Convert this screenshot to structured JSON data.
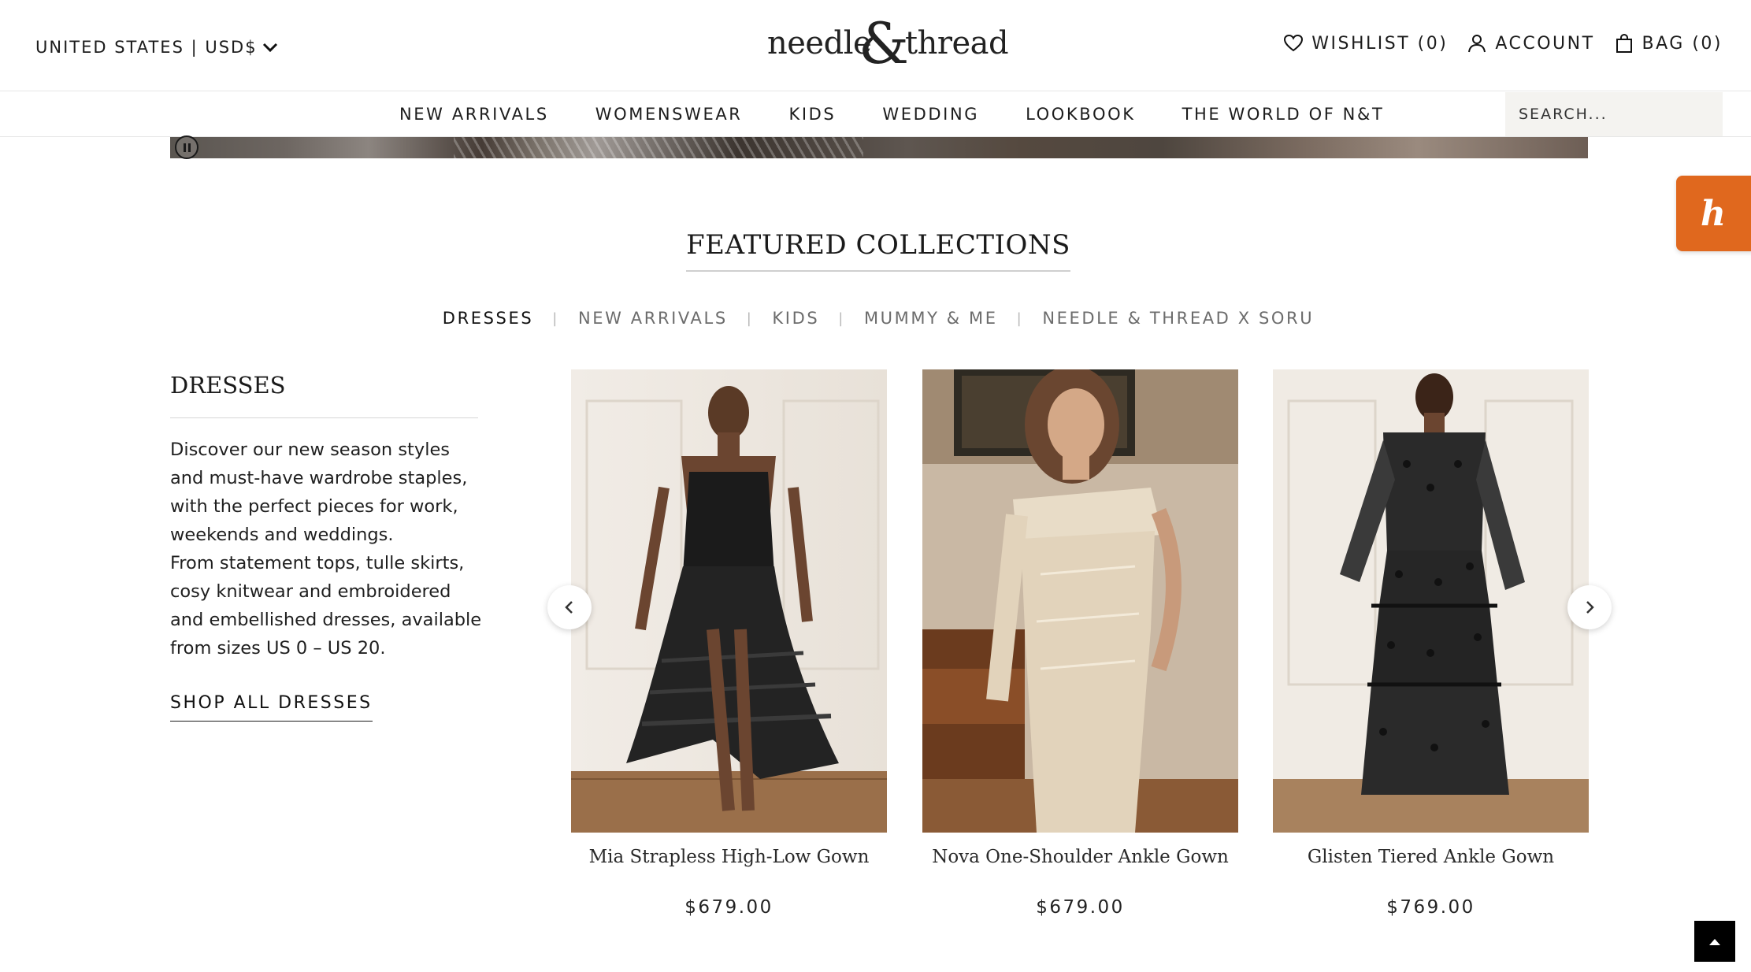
{
  "header": {
    "region_label": "UNITED STATES | USD$",
    "logo": {
      "left_word": "needle",
      "ampersand": "&",
      "right_word": "thread"
    },
    "wishlist_label": "WISHLIST (0)",
    "account_label": "ACCOUNT",
    "bag_label": "BAG (0)"
  },
  "nav": {
    "items": [
      {
        "label": "NEW ARRIVALS"
      },
      {
        "label": "WOMENSWEAR"
      },
      {
        "label": "KIDS"
      },
      {
        "label": "WEDDING"
      },
      {
        "label": "LOOKBOOK"
      },
      {
        "label": "THE WORLD OF N&T"
      }
    ],
    "search_placeholder": "SEARCH..."
  },
  "featured": {
    "title": "FEATURED COLLECTIONS",
    "tabs": [
      {
        "label": "DRESSES",
        "active": true
      },
      {
        "label": "NEW ARRIVALS",
        "active": false
      },
      {
        "label": "KIDS",
        "active": false
      },
      {
        "label": "MUMMY & ME",
        "active": false
      },
      {
        "label": "NEEDLE & THREAD X SORU",
        "active": false
      }
    ],
    "side": {
      "title": "DRESSES",
      "paragraph1": "Discover our new season styles and must-have wardrobe staples, with the perfect pieces for work, weekends and weddings.",
      "paragraph2": "From statement tops, tulle skirts, cosy knitwear and embroidered and embellished dresses, available from sizes US 0 – US 20.",
      "cta": "SHOP ALL DRESSES"
    },
    "products": [
      {
        "name": "Mia Strapless High-Low Gown",
        "price": "$679.00",
        "dress_color": "black tulle"
      },
      {
        "name": "Nova One-Shoulder Ankle Gown",
        "price": "$679.00",
        "dress_color": "champagne sequin"
      },
      {
        "name": "Glisten Tiered Ankle Gown",
        "price": "$769.00",
        "dress_color": "black sequin tulle"
      }
    ]
  },
  "colors": {
    "honey_orange": "#e0681e",
    "search_bg": "#f4f3f0",
    "text": "#1f1f1f"
  },
  "icons": {
    "region": "chevron-down-icon",
    "wishlist": "heart-icon",
    "account": "user-icon",
    "bag": "bag-icon",
    "prev": "chevron-left-icon",
    "next": "chevron-right-icon",
    "back_to_top": "arrow-up-icon",
    "pause": "pause-icon",
    "honey": "honey-extension-icon"
  }
}
